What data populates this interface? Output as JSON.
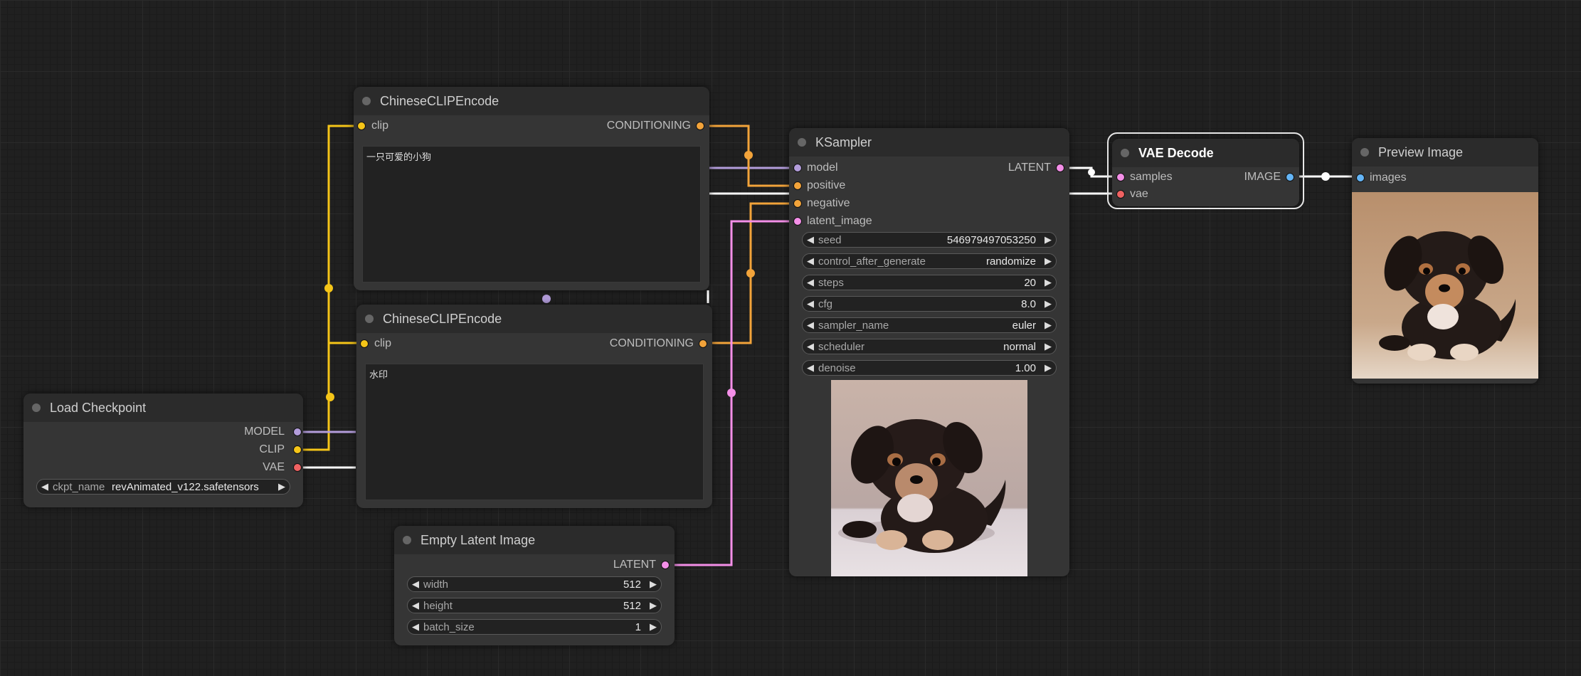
{
  "colors": {
    "clip": "#f5c518",
    "conditioning": "#f2a33a",
    "model": "#b39ddb",
    "latent": "#f48fe8",
    "vae": "#f06262",
    "image": "#64b5f6",
    "white_link": "#ffffff"
  },
  "load_checkpoint": {
    "title": "Load Checkpoint",
    "outputs": {
      "model": "MODEL",
      "clip": "CLIP",
      "vae": "VAE"
    },
    "ckpt_label": "ckpt_name",
    "ckpt_value": "revAnimated_v122.safetensors"
  },
  "clip_encode_positive": {
    "title": "ChineseCLIPEncode",
    "input_clip": "clip",
    "output": "CONDITIONING",
    "text": "一只可爱的小狗"
  },
  "clip_encode_negative": {
    "title": "ChineseCLIPEncode",
    "input_clip": "clip",
    "output": "CONDITIONING",
    "text": "水印"
  },
  "empty_latent": {
    "title": "Empty Latent Image",
    "output": "LATENT",
    "widgets": [
      {
        "label": "width",
        "value": "512"
      },
      {
        "label": "height",
        "value": "512"
      },
      {
        "label": "batch_size",
        "value": "1"
      }
    ]
  },
  "ksampler": {
    "title": "KSampler",
    "inputs": [
      "model",
      "positive",
      "negative",
      "latent_image"
    ],
    "output": "LATENT",
    "widgets": [
      {
        "label": "seed",
        "value": "546979497053250"
      },
      {
        "label": "control_after_generate",
        "value": "randomize"
      },
      {
        "label": "steps",
        "value": "20"
      },
      {
        "label": "cfg",
        "value": "8.0"
      },
      {
        "label": "sampler_name",
        "value": "euler"
      },
      {
        "label": "scheduler",
        "value": "normal"
      },
      {
        "label": "denoise",
        "value": "1.00"
      }
    ],
    "preview": "puppy-preview-image"
  },
  "vae_decode": {
    "title": "VAE Decode",
    "inputs": [
      "samples",
      "vae"
    ],
    "output": "IMAGE"
  },
  "preview_image": {
    "title": "Preview Image",
    "input": "images",
    "image": "puppy-preview-image"
  },
  "arrows": {
    "left": "◀",
    "right": "▶"
  }
}
